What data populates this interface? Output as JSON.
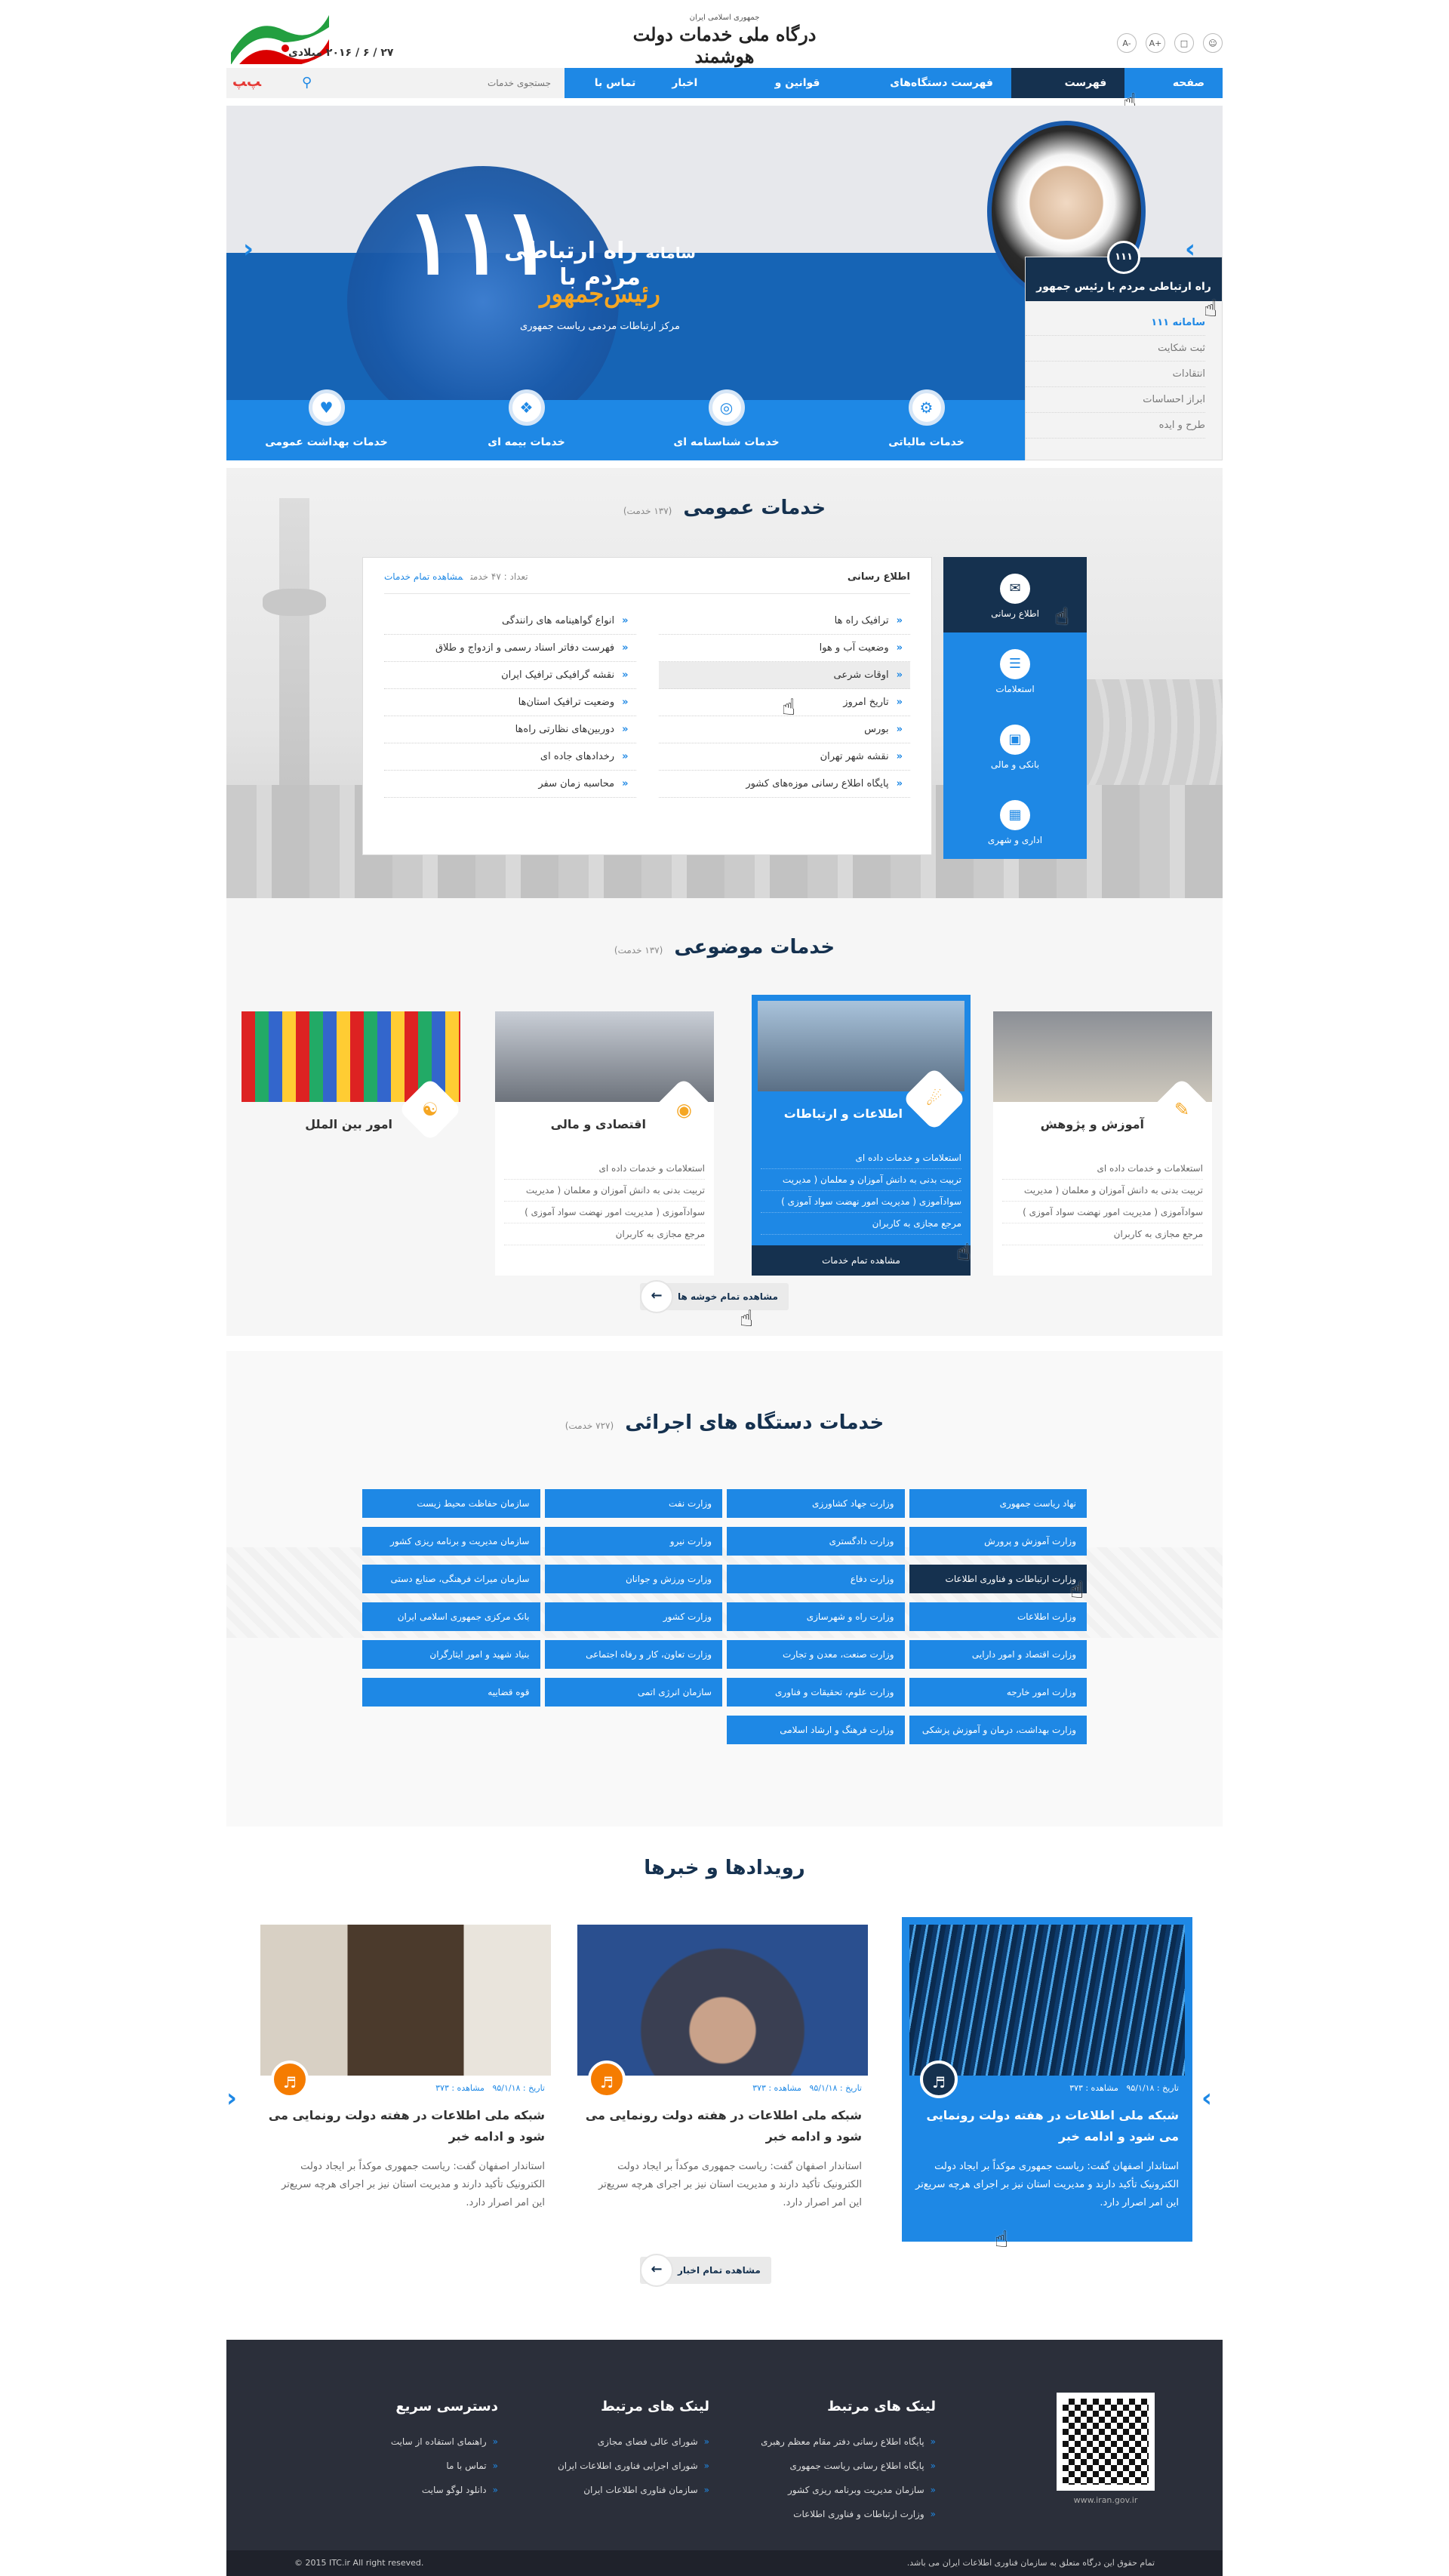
{
  "header": {
    "logo_sub": "جمهوری اسلامی ایران",
    "logo_main": "درگاه ملی خدمات دولت هوشمند",
    "date": "۲۷ / ۶ / ۲۰۱۶  میلادی",
    "icons": [
      "user-icon",
      "chat-icon",
      "font-larger-icon",
      "font-smaller-icon"
    ],
    "font_a1": "A+",
    "font_a2": "A-"
  },
  "nav": {
    "items": [
      "صفحه اصلی",
      "فهرست خدمات",
      "فهرست دستگاه‌های اجرایی",
      "قوانین و مقررات",
      "اخبار",
      "تماس با ما"
    ],
    "active_index": 1
  },
  "search": {
    "placeholder": "جستجوی خدمات",
    "brand": "ﺳﺎﻣﺎﻧﻪ"
  },
  "hero": {
    "number": "۱۱۱",
    "prefix": "سامانه",
    "title": "راه ارتباطی مردم با",
    "title2": "رئیس‌جمهور",
    "sub": "مرکز ارتباطات مردمی ریاست جمهوری",
    "services": [
      "خدمات مالیاتی",
      "خدمات شناسنامه ای",
      "خدمات بیمه ای",
      "خدمات بهداشت عمومی"
    ],
    "panel_badge": "۱۱۱",
    "panel_title": "راه ارتباطی مردم با رئیس جمهور",
    "panel_items": [
      "سامانه ۱۱۱",
      "ثبت شکایت",
      "انتقادات",
      "ابراز احساسات",
      "طرح و ایده"
    ]
  },
  "public_services": {
    "title": "خدمات عمومی",
    "count": "(۱۳۷ خدمت)",
    "tabs": [
      "اطلاع رسانی",
      "استعلامات",
      "بانکی و مالی",
      "اداری و شهری"
    ],
    "box_title": "اطلاع رسانی",
    "box_count": "تعداد : ۴۷ خدمت",
    "box_link": "مشاهده تمام خدمات",
    "col_right": [
      "ترافیک راه ها",
      "وضعیت آب و هوا",
      "اوقات شرعی",
      "تاریخ امروز",
      "بورس",
      "نقشه شهر تهران",
      "پایگاه اطلاع رسانی موزه‌های کشور"
    ],
    "col_left": [
      "انواع گواهینامه های رانندگی",
      "فهرست دفاتر اسناد رسمی و ازدواج و طلاق",
      "نقشه گرافیکی ترافیک ایران",
      "وضعیت ترافیک استان‌ها",
      "دوربین‌های نظارتی راه‌ها",
      "رخدادهای جاده ای",
      "محاسبه زمان سفر"
    ]
  },
  "topic_services": {
    "title": "خدمات موضوعی",
    "count": "(۱۳۷ خدمت)",
    "cards": [
      {
        "title": "آموزش و پژوهش",
        "items": [
          "استعلامات و خدمات داده ای",
          "تربیت بدنی به دانش آموزان و معلمان ( مدیریت",
          "سوادآموزی ( مدیریت امور نهضت سواد آموزی )",
          "مرجع مجازی به کاربران"
        ]
      },
      {
        "title": "اطلاعات و ارتباطات",
        "items": [
          "استعلامات و خدمات داده ای",
          "تربیت بدنی به دانش آموزان و معلمان ( مدیریت",
          "سوادآموزی ( مدیریت امور نهضت سواد آموزی )",
          "مرجع مجازی به کاربران"
        ]
      },
      {
        "title": "اقتصادی و مالی",
        "items": [
          "استعلامات و خدمات داده ای",
          "تربیت بدنی به دانش آموزان و معلمان ( مدیریت",
          "سوادآموزی ( مدیریت امور نهضت سواد آموزی )",
          "مرجع مجازی به کاربران"
        ]
      },
      {
        "title": "امور بین الملل",
        "items": []
      }
    ],
    "card_more": "مشاهده تمام خدمات",
    "all_clusters": "مشاهده تمام خوشه ها"
  },
  "exec_services": {
    "title": "خدمات دستگاه های اجرائی",
    "count": "(۷۲۷ خدمت)",
    "items": [
      "نهاد ریاست جمهوری",
      "وزارت جهاد کشاورزی",
      "وزارت نفت",
      "سازمان حفاظت محیط زیست",
      "وزارت آموزش و پرورش",
      "وزارت دادگستری",
      "وزارت نیرو",
      "سازمان مدیریت و برنامه ریزی کشور",
      "وزارت ارتباطات و فناوری اطلاعات",
      "وزارت دفاع",
      "وزارت ورزش و جوانان",
      "سازمان میراث فرهنگی، صنایع دستی",
      "وزارت اطلاعات",
      "وزارت راه و شهرسازی",
      "وزارت کشور",
      "بانک مرکزی جمهوری اسلامی ایران",
      "وزارت اقتصاد و امور دارایی",
      "وزارت صنعت، معدن و تجارت",
      "وزارت تعاون، کار و رفاه اجتماعی",
      "بنیاد شهید و امور ایثارگران",
      "وزارت امور خارجه",
      "وزارت علوم، تحقیقات و فناوری",
      "سازمان انرژی اتمی",
      "قوه قضاییه",
      "وزارت بهداشت، درمان و آموزش پزشکی",
      "وزارت فرهنگ و ارشاد اسلامی",
      "",
      ""
    ],
    "active_index": 8
  },
  "news": {
    "title": "رویدادها و خبرها",
    "cards": [
      {
        "date": "تاریخ : ۹۵/۱/۱۸",
        "views": "مشاهده : ۳۷۳",
        "title": "شبکه ملی اطلاعات در هفته دولت رونمایی می شود و ادامه خبر",
        "text": "استاندار اصفهان گفت: ریاست جمهوری موکداً بر ایجاد دولت الکترونیک تأکید دارند و مدیریت استان نیز بر اجرای هرچه سریع‌تر این امر اصرار دارد."
      },
      {
        "date": "تاریخ : ۹۵/۱/۱۸",
        "views": "مشاهده : ۳۷۳",
        "title": "شبکه ملی اطلاعات در هفته دولت رونمایی می شود و ادامه خبر",
        "text": "استاندار اصفهان گفت: ریاست جمهوری موکداً بر ایجاد دولت الکترونیک تأکید دارند و مدیریت استان نیز بر اجرای هرچه سریع‌تر این امر اصرار دارد."
      },
      {
        "date": "تاریخ : ۹۵/۱/۱۸",
        "views": "مشاهده : ۳۷۳",
        "title": "شبکه ملی اطلاعات در هفته دولت رونمایی می شود و ادامه خبر",
        "text": "استاندار اصفهان گفت: ریاست جمهوری موکداً بر ایجاد دولت الکترونیک تأکید دارند و مدیریت استان نیز بر اجرای هرچه سریع‌تر این امر اصرار دارد."
      }
    ],
    "all_news": "مشاهده تمام اخبار"
  },
  "footer": {
    "url": "www.iran.gov.ir",
    "col1_title": "لینک های مرتبط",
    "col1": [
      "پایگاه اطلاع رسانی دفتر مقام معظم رهبری",
      "پایگاه اطلاع رسانی ریاست جمهوری",
      "سازمان مدیریت وبرنامه ریزی کشور",
      "وزارت ارتباطات و فناوری اطلاعات"
    ],
    "col2_title": "لینک های مرتبط",
    "col2": [
      "شورای عالی فضای مجازی",
      "شورای اجرایی فناوری اطلاعات ایران",
      "سازمان فناوری اطلاعات ایران"
    ],
    "col3_title": "دسترسی سریع",
    "col3": [
      "راهنمای استفاده از سایت",
      "تماس با ما",
      "دانلود لوگو سایت"
    ],
    "copyright_fa": "تمام حقوق این درگاه متعلق به سازمان فناوری اطلاعات ایران می باشد.",
    "copyright_en": "© 2015 ITC.ir All right reseved."
  }
}
